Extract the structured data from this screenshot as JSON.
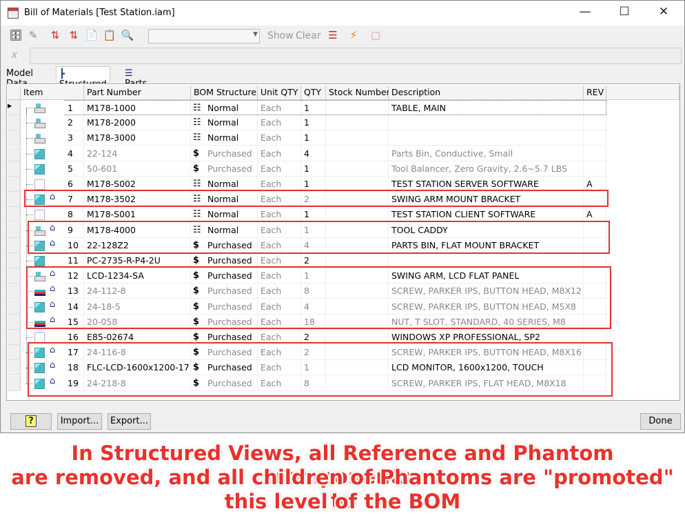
{
  "window": {
    "title": "Bill of Materials [Test Station.iam]"
  },
  "toolbar": {
    "show_label": "Show",
    "clear_label": "Clear",
    "combo_value": ""
  },
  "tabs": [
    {
      "label": "Model Data"
    },
    {
      "label": "Structured",
      "active": true
    },
    {
      "label": "Parts Only"
    }
  ],
  "columns": [
    "Item",
    "Part Number",
    "BOM Structure",
    "Unit QTY",
    "QTY",
    "Stock Number",
    "Description",
    "REV"
  ],
  "rows": [
    {
      "item": "1",
      "part": "M178-1000",
      "bom": "Normal",
      "unit": "Each",
      "qty": "1",
      "stock": "",
      "desc": "TABLE, MAIN",
      "rev": "",
      "icon": "assembly",
      "promoted": false,
      "gray": false,
      "qtyGray": false,
      "selected": true
    },
    {
      "item": "2",
      "part": "M178-2000",
      "bom": "Normal",
      "unit": "Each",
      "qty": "1",
      "stock": "",
      "desc": "",
      "rev": "",
      "icon": "assembly",
      "promoted": false,
      "gray": false,
      "qtyGray": false
    },
    {
      "item": "3",
      "part": "M178-3000",
      "bom": "Normal",
      "unit": "Each",
      "qty": "1",
      "stock": "",
      "desc": "",
      "rev": "",
      "icon": "assembly",
      "promoted": false,
      "gray": false,
      "qtyGray": false
    },
    {
      "item": "4",
      "part": "22-124",
      "bom": "Purchased",
      "unit": "Each",
      "qty": "4",
      "stock": "",
      "desc": "Parts Bin, Conductive, Small",
      "rev": "",
      "icon": "part",
      "promoted": false,
      "gray": true,
      "qtyGray": false
    },
    {
      "item": "5",
      "part": "50-601",
      "bom": "Purchased",
      "unit": "Each",
      "qty": "1",
      "stock": "",
      "desc": "Tool Balancer,  Zero Gravity, 2.6~5.7 LBS",
      "rev": "",
      "icon": "part",
      "promoted": false,
      "gray": true,
      "qtyGray": false
    },
    {
      "item": "6",
      "part": "M178-S002",
      "bom": "Normal",
      "unit": "Each",
      "qty": "1",
      "stock": "",
      "desc": "TEST STATION SERVER SOFTWARE",
      "rev": "A",
      "icon": "virtual",
      "promoted": false,
      "gray": false,
      "qtyGray": false
    },
    {
      "item": "7",
      "part": "M178-3502",
      "bom": "Normal",
      "unit": "Each",
      "qty": "2",
      "stock": "",
      "desc": "SWING ARM MOUNT BRACKET",
      "rev": "",
      "icon": "part",
      "promoted": true,
      "gray": false,
      "qtyGray": true
    },
    {
      "item": "8",
      "part": "M178-S001",
      "bom": "Normal",
      "unit": "Each",
      "qty": "1",
      "stock": "",
      "desc": "TEST STATION CLIENT SOFTWARE",
      "rev": "A",
      "icon": "virtual",
      "promoted": false,
      "gray": false,
      "qtyGray": false
    },
    {
      "item": "9",
      "part": "M178-4000",
      "bom": "Normal",
      "unit": "Each",
      "qty": "1",
      "stock": "",
      "desc": "TOOL CADDY",
      "rev": "",
      "icon": "assembly",
      "promoted": true,
      "gray": false,
      "qtyGray": true
    },
    {
      "item": "10",
      "part": "22-128Z2",
      "bom": "Purchased",
      "unit": "Each",
      "qty": "4",
      "stock": "",
      "desc": "PARTS BIN, FLAT MOUNT BRACKET",
      "rev": "",
      "icon": "part",
      "promoted": true,
      "gray": false,
      "qtyGray": true
    },
    {
      "item": "11",
      "part": "PC-2735-R-P4-2U",
      "bom": "Purchased",
      "unit": "Each",
      "qty": "2",
      "stock": "",
      "desc": "",
      "rev": "",
      "icon": "part",
      "promoted": false,
      "gray": false,
      "qtyGray": false
    },
    {
      "item": "12",
      "part": "LCD-1234-SA",
      "bom": "Purchased",
      "unit": "Each",
      "qty": "1",
      "stock": "",
      "desc": "SWING ARM, LCD FLAT PANEL",
      "rev": "",
      "icon": "assembly",
      "promoted": true,
      "gray": false,
      "qtyGray": true
    },
    {
      "item": "13",
      "part": "24-112-8",
      "bom": "Purchased",
      "unit": "Each",
      "qty": "8",
      "stock": "",
      "desc": "SCREW, PARKER IPS, BUTTON HEAD, M8X12",
      "rev": "",
      "icon": "content",
      "promoted": true,
      "gray": true,
      "qtyGray": true
    },
    {
      "item": "14",
      "part": "24-18-5",
      "bom": "Purchased",
      "unit": "Each",
      "qty": "4",
      "stock": "",
      "desc": "SCREW, PARKER IPS, BUTTON HEAD, M5X8",
      "rev": "",
      "icon": "part",
      "promoted": true,
      "gray": true,
      "qtyGray": true
    },
    {
      "item": "15",
      "part": "20-058",
      "bom": "Purchased",
      "unit": "Each",
      "qty": "18",
      "stock": "",
      "desc": "NUT, T SLOT, STANDARD, 40 SERIES, M8",
      "rev": "",
      "icon": "content",
      "promoted": true,
      "gray": true,
      "qtyGray": true
    },
    {
      "item": "16",
      "part": "E85-02674",
      "bom": "Purchased",
      "unit": "Each",
      "qty": "2",
      "stock": "",
      "desc": "WINDOWS XP PROFESSIONAL, SP2",
      "rev": "",
      "icon": "virtual",
      "promoted": false,
      "gray": false,
      "qtyGray": false
    },
    {
      "item": "17",
      "part": "24-116-8",
      "bom": "Purchased",
      "unit": "Each",
      "qty": "2",
      "stock": "",
      "desc": "SCREW, PARKER IPS, BUTTON HEAD, M8X16",
      "rev": "",
      "icon": "part",
      "promoted": true,
      "gray": true,
      "qtyGray": true
    },
    {
      "item": "18",
      "part": "FLC-LCD-1600x1200-17",
      "bom": "Purchased",
      "unit": "Each",
      "qty": "1",
      "stock": "",
      "desc": "LCD MONITOR, 1600x1200, TOUCH",
      "rev": "",
      "icon": "part",
      "promoted": true,
      "gray": false,
      "qtyGray": true
    },
    {
      "item": "19",
      "part": "24-218-8",
      "bom": "Purchased",
      "unit": "Each",
      "qty": "8",
      "stock": "",
      "desc": "SCREW, PARKER IPS, FLAT HEAD, M8X18",
      "rev": "",
      "icon": "part",
      "promoted": true,
      "gray": true,
      "qtyGray": true
    }
  ],
  "footer": {
    "help_label": "?",
    "import_label": "Import...",
    "export_label": "Export...",
    "done_label": "Done"
  },
  "caption": {
    "lines": [
      "In Structured Views, all Reference and Phantom components",
      "are removed, and all children of Phantoms are \"promoted\" to",
      "this level of the BOM"
    ]
  },
  "colors": {
    "highlight_box": "#e83030",
    "caption": "#e8322c",
    "part_icon": "#5bc8d0",
    "promoted_icon": "#1a3a8a"
  }
}
